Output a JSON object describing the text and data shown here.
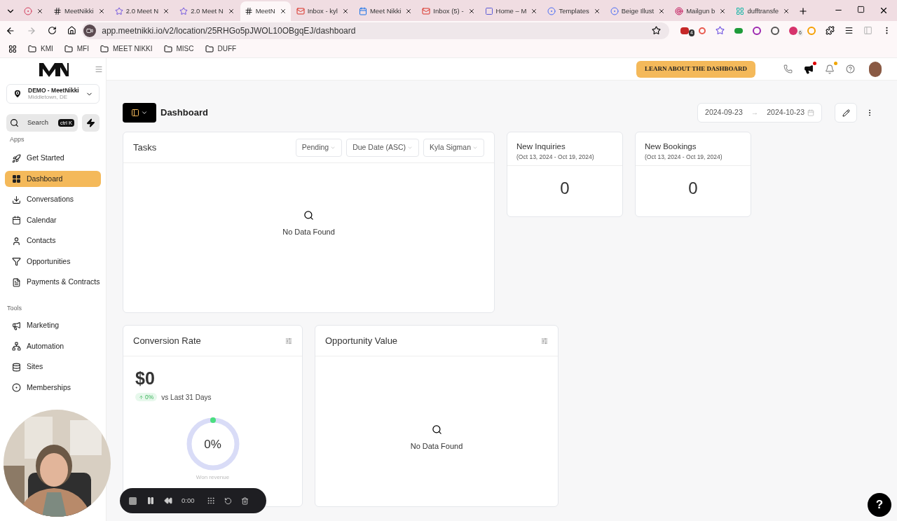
{
  "browser": {
    "tabs": [
      {
        "selected": false
      },
      {
        "label": "MeetNikki",
        "selected": false
      },
      {
        "label": "2.0 Meet N",
        "selected": false
      },
      {
        "label": "2.0 Meet N",
        "selected": false
      },
      {
        "label": "MeetN",
        "selected": true
      },
      {
        "label": "Inbox - kyl",
        "selected": false
      },
      {
        "label": "Meet Nikki",
        "selected": false
      },
      {
        "label": "Inbox (5) -",
        "selected": false
      },
      {
        "label": "Home – M",
        "selected": false
      },
      {
        "label": "Templates",
        "selected": false
      },
      {
        "label": "Beige Illust",
        "selected": false
      },
      {
        "label": "Mailgun b",
        "selected": false
      },
      {
        "label": "dufftransfe",
        "selected": false
      }
    ],
    "url": "app.meetnikki.io/v2/location/25RHGo5pJWOL10OBgqEJ/dashboard",
    "extension_badges": [
      "4",
      "6"
    ],
    "bookmarks": [
      "KMI",
      "MFI",
      "MEET NIKKI",
      "MISC",
      "DUFF"
    ]
  },
  "header": {
    "learn_button": "LEARN ABOUT THE DASHBOARD"
  },
  "sidebar": {
    "account": {
      "name": "DEMO - MeetNikki",
      "location": "Middletown, DE"
    },
    "search": {
      "placeholder": "Search",
      "shortcut": "ctrl K"
    },
    "sections": [
      {
        "title": "Apps",
        "items": [
          {
            "label": "Get Started",
            "selected": false
          },
          {
            "label": "Dashboard",
            "selected": true
          },
          {
            "label": "Conversations",
            "selected": false
          },
          {
            "label": "Calendar",
            "selected": false
          },
          {
            "label": "Contacts",
            "selected": false
          },
          {
            "label": "Opportunities",
            "selected": false
          },
          {
            "label": "Payments & Contracts",
            "selected": false
          }
        ]
      },
      {
        "title": "Tools",
        "items": [
          {
            "label": "Marketing",
            "selected": false
          },
          {
            "label": "Automation",
            "selected": false
          },
          {
            "label": "Sites",
            "selected": false
          },
          {
            "label": "Memberships",
            "selected": false
          }
        ]
      }
    ]
  },
  "page": {
    "title": "Dashboard",
    "date_from": "2024-09-23",
    "date_separator": "→",
    "date_to": "2024-10-23"
  },
  "tasks": {
    "title": "Tasks",
    "filters": [
      "Pending",
      "Due Date (ASC)",
      "Kyla Sigman"
    ],
    "empty": "No Data Found"
  },
  "stats": [
    {
      "title": "New Inquiries",
      "range": "(Oct 13, 2024 - Oct 19, 2024)",
      "value": "0"
    },
    {
      "title": "New Bookings",
      "range": "(Oct 13, 2024 - Oct 19, 2024)",
      "value": "0"
    }
  ],
  "conversion": {
    "title": "Conversion Rate",
    "amount": "$0",
    "change": "0%",
    "compare": "vs Last 31 Days",
    "level": 0,
    "ring_label": "0%",
    "caption": "Won revenue"
  },
  "opportunity": {
    "title": "Opportunity Value",
    "empty": "No Data Found"
  },
  "recorder": {
    "time": "0:00"
  },
  "help_button": "?"
}
